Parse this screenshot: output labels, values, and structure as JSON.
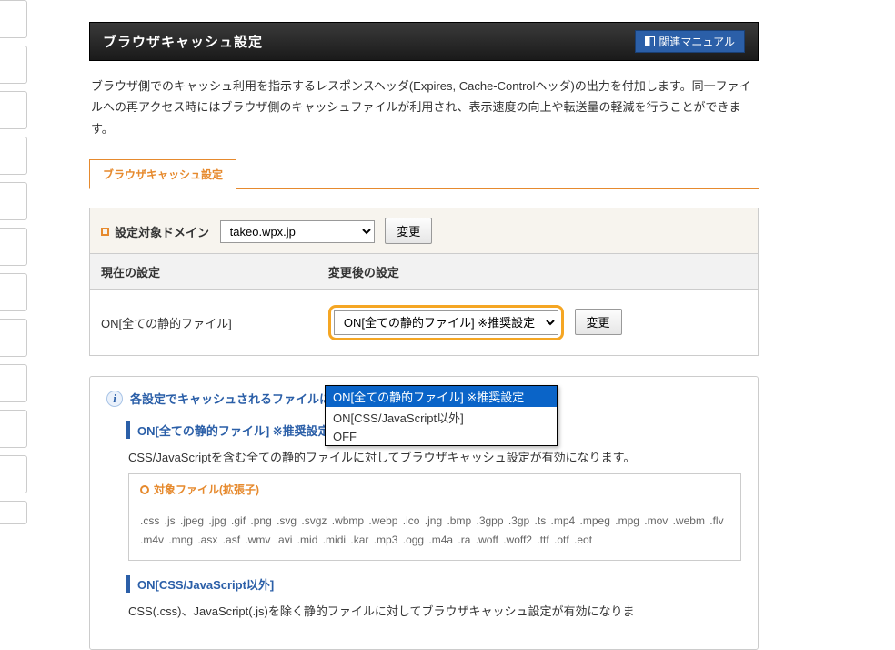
{
  "header": {
    "title": "ブラウザキャッシュ設定",
    "manual_label": "関連マニュアル"
  },
  "description": "ブラウザ側でのキャッシュ利用を指示するレスポンスヘッダ(Expires, Cache-Controlヘッダ)の出力を付加します。同一ファイルへの再アクセス時にはブラウザ側のキャッシュファイルが利用され、表示速度の向上や転送量の軽減を行うことができます。",
  "tab": {
    "active": "ブラウザキャッシュ設定"
  },
  "domain": {
    "label": "設定対象ドメイン",
    "selected": "takeo.wpx.jp",
    "change_btn": "変更"
  },
  "table": {
    "col1": "現在の設定",
    "col2": "変更後の設定",
    "current_value": "ON[全ての静的ファイル]",
    "select_value": "ON[全ての静的ファイル] ※推奨設定",
    "change_btn": "変更"
  },
  "dropdown": {
    "options": [
      "ON[全ての静的ファイル] ※推奨設定",
      "ON[CSS/JavaScript以外]",
      "OFF"
    ],
    "selected_index": 0
  },
  "info": {
    "heading": "各設定でキャッシュされるファイルについて",
    "section1": {
      "title": "ON[全ての静的ファイル] ※推奨設定",
      "text": "CSS/JavaScriptを含む全ての静的ファイルに対してブラウザキャッシュ設定が有効になります。",
      "filebox_title": "対象ファイル(拡張子)",
      "filebox_body": ".css .js .jpeg .jpg .gif .png .svg .svgz .wbmp .webp .ico .jng .bmp .3gpp .3gp .ts .mp4 .mpeg .mpg .mov .webm .flv .m4v .mng .asx .asf .wmv .avi .mid .midi .kar .mp3 .ogg .m4a .ra .woff .woff2 .ttf .otf .eot"
    },
    "section2": {
      "title": "ON[CSS/JavaScript以外]",
      "text": "CSS(.css)、JavaScript(.js)を除く静的ファイルに対してブラウザキャッシュ設定が有効になりま"
    }
  }
}
